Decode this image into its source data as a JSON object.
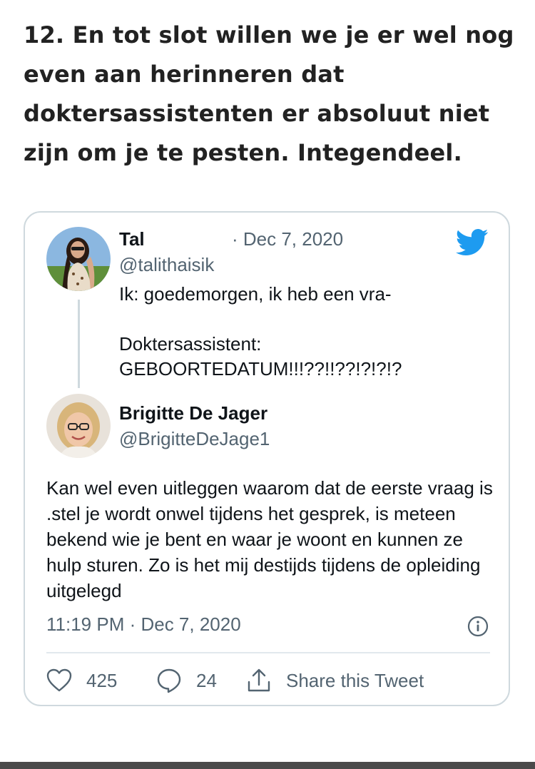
{
  "article": {
    "heading": "12. En tot slot willen we je er wel nog even aan herinneren dat doktersassistenten er absoluut niet zijn om je te pesten. Integendeel."
  },
  "embedded_tweet": {
    "quoted": {
      "name": "Tal",
      "date": "· Dec 7, 2020",
      "handle": "@talithaisik",
      "body": "Ik: goedemorgen, ik heb een vra-\n\nDoktersassistent:\nGEBOORTEDATUM!!!??!!??!?!?!?"
    },
    "reply": {
      "name": "Brigitte De Jager",
      "handle": "@BrigitteDeJage1",
      "body": "Kan wel even uitleggen waarom dat de eerste vraag is .stel je wordt onwel tijdens het gesprek, is meteen bekend wie je bent en waar je woont en kunnen ze hulp sturen. Zo is het mij destijds tijdens de opleiding uitgelegd",
      "timestamp": "11:19 PM · Dec 7, 2020"
    },
    "actions": {
      "likes": "425",
      "replies": "24",
      "share_label": "Share this Tweet"
    },
    "icons": {
      "brand": "twitter-bird-icon",
      "info": "info-icon",
      "like": "heart-icon",
      "reply": "speech-bubble-icon",
      "share": "share-icon"
    },
    "colors": {
      "twitter_blue": "#1d9bf0",
      "text": "#0f1419",
      "muted": "#536471",
      "border": "#cfd9de"
    }
  }
}
